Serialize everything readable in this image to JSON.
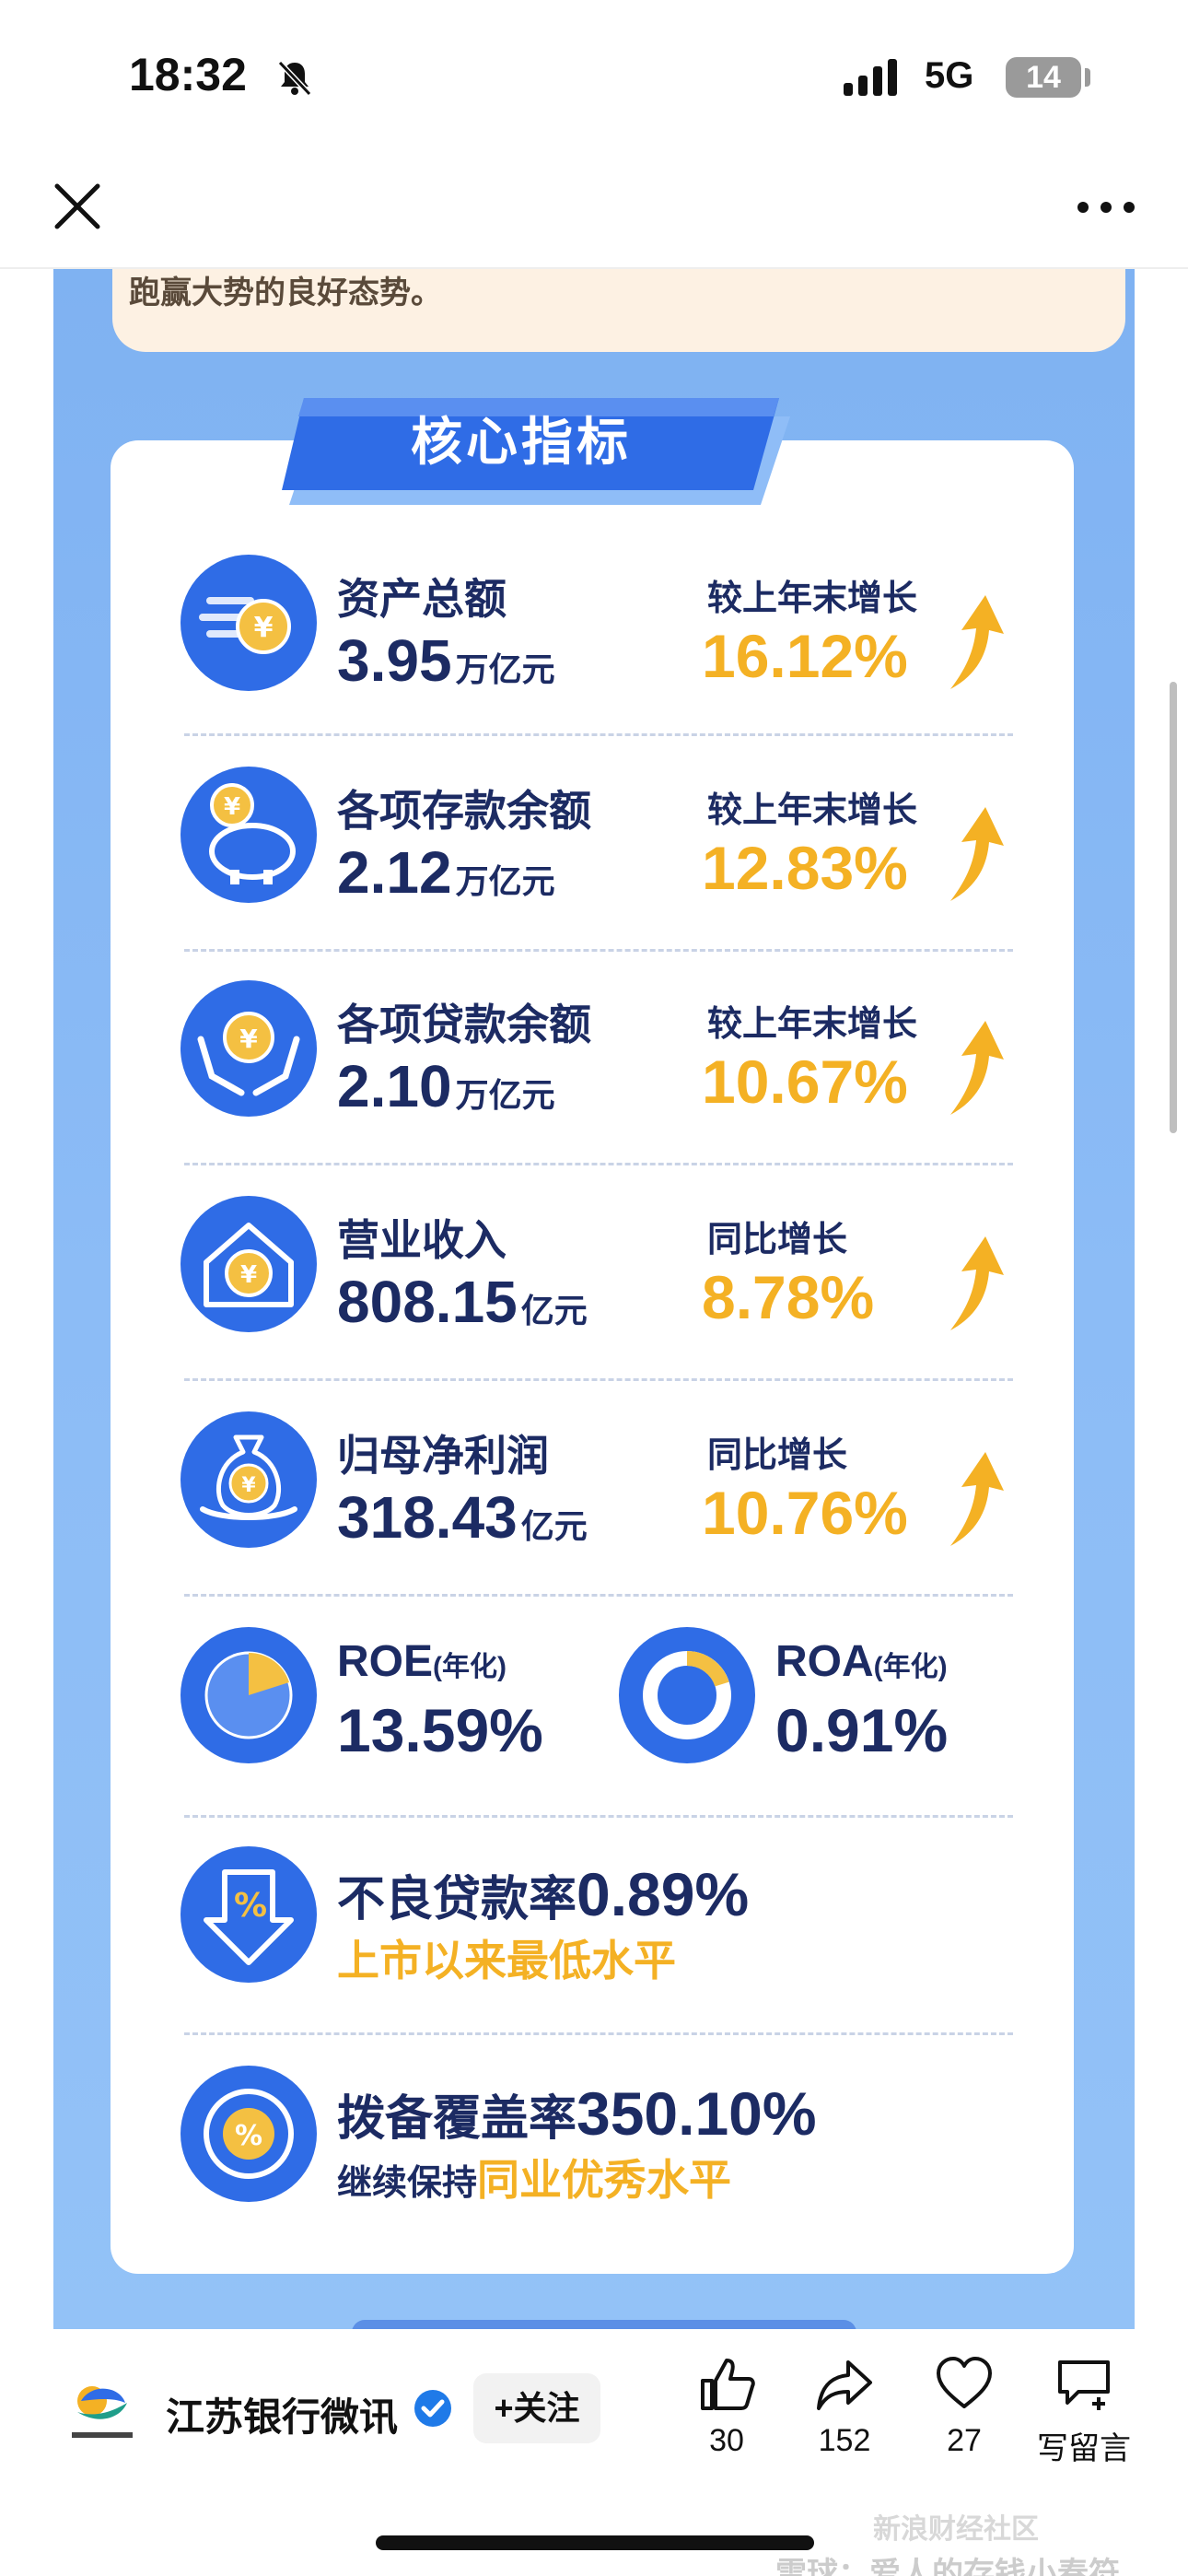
{
  "status_bar": {
    "time": "18:32",
    "network": "5G",
    "battery": "14"
  },
  "article": {
    "intro_text": "跑赢大势的良好态势。",
    "section_title": "核心指标",
    "metrics": [
      {
        "label": "资产总额",
        "value": "3.95",
        "unit": "万亿元",
        "growth_label": "较上年末增长",
        "growth_value": "16.12%"
      },
      {
        "label": "各项存款余额",
        "value": "2.12",
        "unit": "万亿元",
        "growth_label": "较上年末增长",
        "growth_value": "12.83%"
      },
      {
        "label": "各项贷款余额",
        "value": "2.10",
        "unit": "万亿元",
        "growth_label": "较上年末增长",
        "growth_value": "10.67%"
      },
      {
        "label": "营业收入",
        "value": "808.15",
        "unit": "亿元",
        "growth_label": "同比增长",
        "growth_value": "8.78%"
      },
      {
        "label": "归母净利润",
        "value": "318.43",
        "unit": "亿元",
        "growth_label": "同比增长",
        "growth_value": "10.76%"
      }
    ],
    "roe": {
      "label": "ROE",
      "note": "(年化)",
      "value": "13.59%"
    },
    "roa": {
      "label": "ROA",
      "note": "(年化)",
      "value": "0.91%"
    },
    "npl": {
      "label": "不良贷款率",
      "value": "0.89%",
      "sub": "上市以来最低水平"
    },
    "coverage": {
      "label": "拨备覆盖率",
      "value": "350.10%",
      "sub_prefix": "继续保持",
      "sub_highlight": "同业优秀水平"
    },
    "colors": {
      "accent_yellow": "#f4b124",
      "navy": "#1c2b63",
      "blue": "#3f7ff0"
    }
  },
  "bottom_bar": {
    "account_name": "江苏银行微讯",
    "follow_label": "+关注",
    "like_count": "30",
    "share_count": "152",
    "favorite_count": "27",
    "comment_label": "写留言"
  },
  "watermark": {
    "sina": "新浪财经社区",
    "xueqiu": "雪球：爱人的存钱小春符"
  }
}
